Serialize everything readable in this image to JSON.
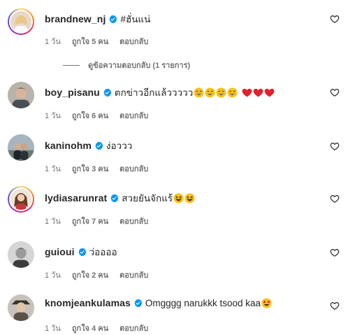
{
  "comments": [
    {
      "username": "brandnew_nj",
      "text": "#ฮั่นแน่",
      "emojis": [],
      "time": "1 วัน",
      "likes": "ถูกใจ 5 คน",
      "reply": "ตอบกลับ",
      "story_ring": true,
      "view_replies": "ดูข้อความตอบกลับ (1 รายการ)"
    },
    {
      "username": "boy_pisanu",
      "text": "ตกข่าวอีกแล้ววววว",
      "emojis": [
        "grin-sweat",
        "grin-sweat",
        "grin-sweat",
        "grin-sweat",
        "red-heart",
        "red-heart",
        "red-heart"
      ],
      "time": "1 วัน",
      "likes": "ถูกใจ 6 คน",
      "reply": "ตอบกลับ",
      "story_ring": false
    },
    {
      "username": "kaninohm",
      "text": "ง่อววว",
      "emojis": [],
      "time": "1 วัน",
      "likes": "ถูกใจ 3 คน",
      "reply": "ตอบกลับ",
      "story_ring": false
    },
    {
      "username": "lydiasarunrat",
      "text": "สวยยันจักแร้",
      "emojis": [
        "squint-laugh",
        "squint-laugh"
      ],
      "time": "1 วัน",
      "likes": "ถูกใจ 7 คน",
      "reply": "ตอบกลับ",
      "story_ring": true
    },
    {
      "username": "guioui",
      "text": "ว่ออออ",
      "emojis": [],
      "time": "1 วัน",
      "likes": "ถูกใจ 2 คน",
      "reply": "ตอบกลับ",
      "story_ring": false
    },
    {
      "username": "knomjeankulamas",
      "text": "Omgggg narukkk tsood kaa",
      "emojis": [
        "star-struck"
      ],
      "time": "1 วัน",
      "likes": "ถูกใจ 4 คน",
      "reply": "ตอบกลับ",
      "story_ring": false
    }
  ],
  "icons": {
    "verified": "verified-badge-icon",
    "like": "heart-outline-icon"
  },
  "colors": {
    "verified_blue": "#0095f6",
    "meta_gray": "#737373",
    "text": "#262626"
  }
}
